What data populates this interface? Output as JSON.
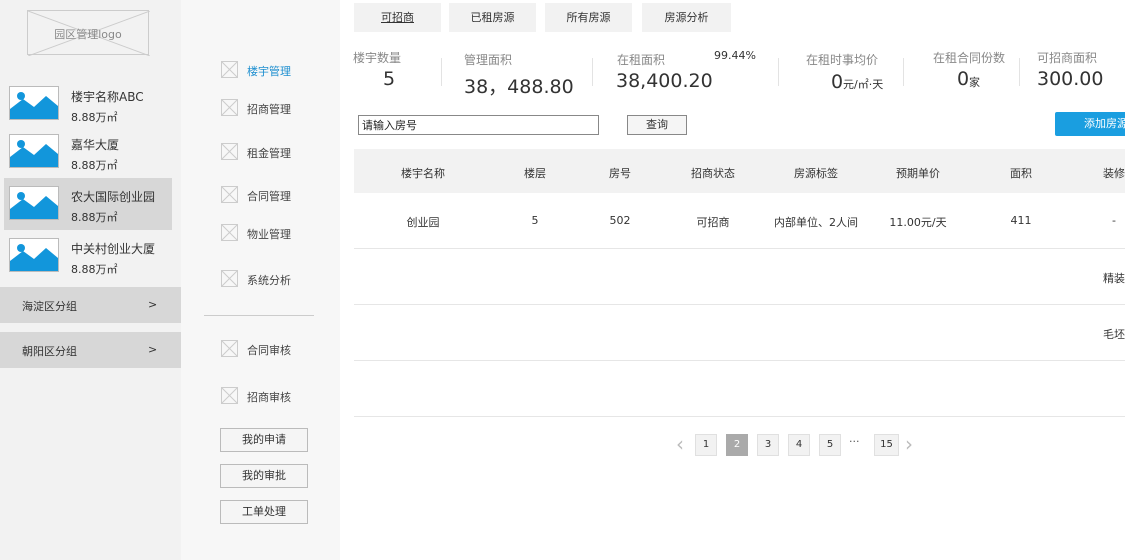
{
  "logo": {
    "text": "园区管理logo"
  },
  "buildings": [
    {
      "name": "楼宇名称ABC",
      "size": "8.88万㎡"
    },
    {
      "name": "嘉华大厦",
      "size": "8.88万㎡"
    },
    {
      "name": "农大国际创业园",
      "size": "8.88万㎡"
    },
    {
      "name": "中关村创业大厦",
      "size": "8.88万㎡"
    }
  ],
  "groups": [
    {
      "label": "海淀区分组",
      "arrow": ">"
    },
    {
      "label": "朝阳区分组",
      "arrow": ">"
    }
  ],
  "menu": {
    "items": [
      {
        "label": "楼宇管理"
      },
      {
        "label": "招商管理"
      },
      {
        "label": "租金管理"
      },
      {
        "label": "合同管理"
      },
      {
        "label": "物业管理"
      },
      {
        "label": "系统分析"
      }
    ],
    "review_items": [
      {
        "label": "合同审核"
      },
      {
        "label": "招商审核"
      }
    ],
    "buttons": [
      {
        "label": "我的申请"
      },
      {
        "label": "我的审批"
      },
      {
        "label": "工单处理"
      }
    ]
  },
  "tabs": [
    {
      "label": "可招商"
    },
    {
      "label": "已租房源"
    },
    {
      "label": "所有房源"
    },
    {
      "label": "房源分析"
    }
  ],
  "stats": {
    "building_count": {
      "label": "楼宇数量",
      "value": "5"
    },
    "managed_area": {
      "label": "管理面积",
      "value": "38，488.80"
    },
    "rented_area": {
      "label": "在租面积",
      "value": "38,400.20",
      "rate": "99.44%"
    },
    "avg_price": {
      "label": "在租时事均价",
      "value": "0",
      "unit": "元/㎡·天"
    },
    "contracts": {
      "label": "在租合同份数",
      "value": "0",
      "unit": "家"
    },
    "available_area": {
      "label": "可招商面积",
      "value": "300.00"
    }
  },
  "search": {
    "placeholder": "请输入房号",
    "button": "查询"
  },
  "add_button": "添加房源",
  "table": {
    "headers": [
      "楼宇名称",
      "楼层",
      "房号",
      "招商状态",
      "房源标签",
      "预期单价",
      "面积",
      "装修"
    ],
    "rows": [
      [
        "创业园",
        "5",
        "502",
        "可招商",
        "内部单位、2人间",
        "11.00元/天",
        "411",
        "-"
      ],
      [
        "",
        "",
        "",
        "",
        "",
        "",
        "",
        "精装"
      ],
      [
        "",
        "",
        "",
        "",
        "",
        "",
        "",
        "毛坯"
      ],
      [
        "",
        "",
        "",
        "",
        "",
        "",
        "",
        ""
      ]
    ]
  },
  "pagination": {
    "prev": "‹",
    "pages": [
      "1",
      "2",
      "3",
      "4",
      "5"
    ],
    "ellipsis": "···",
    "last": "15",
    "next": "›",
    "current": "2"
  },
  "colors": {
    "accent": "#1a9ee0",
    "active_menu": "#1e8fd0",
    "image_blue": "#1296db"
  }
}
